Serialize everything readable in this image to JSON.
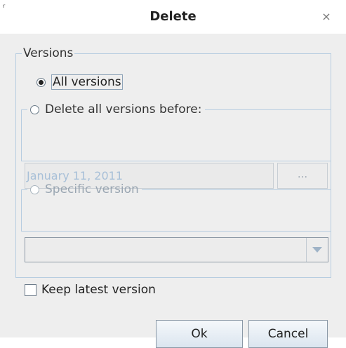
{
  "dialog": {
    "corner_mark": "r",
    "title": "Delete",
    "close_icon": "close-icon",
    "close_symbol": "×"
  },
  "versions": {
    "legend": "Versions",
    "all_versions": {
      "label": "All versions",
      "selected": true
    },
    "before": {
      "label": "Delete all versions before:",
      "selected": false,
      "date_value": "January 11, 2011",
      "date_button_label": "..."
    },
    "specific": {
      "label": "Specific version",
      "selected": false,
      "value": ""
    },
    "keep_latest": {
      "label": "Keep latest version",
      "checked": false
    }
  },
  "buttons": {
    "ok_label": "Ok",
    "cancel_label": "Cancel"
  },
  "colors": {
    "border_accent": "#b7cde0",
    "disabled_text": "#a8c0d8",
    "button_gradient_top": "#f5f8fb",
    "button_gradient_bottom": "#dbe5ef"
  }
}
